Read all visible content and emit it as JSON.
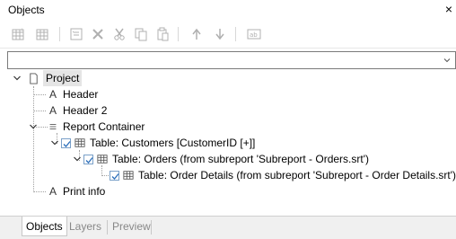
{
  "panel": {
    "title": "Objects",
    "close_glyph": "×"
  },
  "toolbar": {
    "buttons": [
      {
        "icon": "insert-table-icon"
      },
      {
        "icon": "insert-table-2-icon"
      },
      {
        "icon": "properties-icon"
      },
      {
        "icon": "delete-icon"
      },
      {
        "icon": "cut-icon"
      },
      {
        "icon": "copy-icon"
      },
      {
        "icon": "paste-icon"
      },
      {
        "icon": "move-up-icon"
      },
      {
        "icon": "move-down-icon"
      },
      {
        "icon": "rename-icon"
      }
    ]
  },
  "combo": {
    "value": ""
  },
  "tree": {
    "nodes": [
      {
        "label": "Project",
        "icon": "page-icon"
      },
      {
        "label": "Header",
        "icon": "text-a-icon"
      },
      {
        "label": "Header 2",
        "icon": "text-a-icon"
      },
      {
        "label": "Report Container",
        "icon": "list-icon"
      },
      {
        "label": "Table: Customers [CustomerID [+]]",
        "icon": "table-icon"
      },
      {
        "label": "Table: Orders (from subreport 'Subreport - Orders.srt')",
        "icon": "table-icon"
      },
      {
        "label": "Table: Order Details (from subreport 'Subreport - Order Details.srt')",
        "icon": "table-icon"
      },
      {
        "label": "Print info",
        "icon": "text-a-icon"
      }
    ]
  },
  "tabs": [
    {
      "label": "Objects",
      "active": true
    },
    {
      "label": "Layers",
      "active": false
    },
    {
      "label": "Preview",
      "active": false
    }
  ]
}
